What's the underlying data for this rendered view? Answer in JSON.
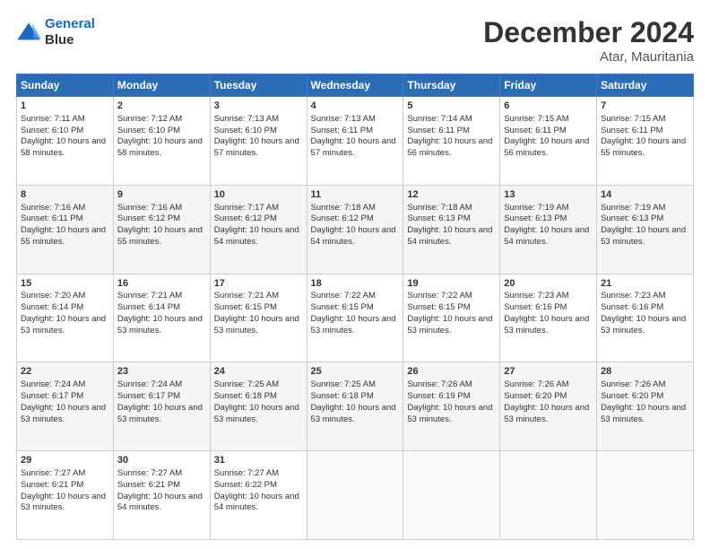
{
  "header": {
    "logo_line1": "General",
    "logo_line2": "Blue",
    "month_title": "December 2024",
    "location": "Atar, Mauritania"
  },
  "weekdays": [
    "Sunday",
    "Monday",
    "Tuesday",
    "Wednesday",
    "Thursday",
    "Friday",
    "Saturday"
  ],
  "weeks": [
    [
      {
        "day": "1",
        "sunrise": "7:11 AM",
        "sunset": "6:10 PM",
        "daylight": "10 hours and 58 minutes."
      },
      {
        "day": "2",
        "sunrise": "7:12 AM",
        "sunset": "6:10 PM",
        "daylight": "10 hours and 58 minutes."
      },
      {
        "day": "3",
        "sunrise": "7:13 AM",
        "sunset": "6:10 PM",
        "daylight": "10 hours and 57 minutes."
      },
      {
        "day": "4",
        "sunrise": "7:13 AM",
        "sunset": "6:11 PM",
        "daylight": "10 hours and 57 minutes."
      },
      {
        "day": "5",
        "sunrise": "7:14 AM",
        "sunset": "6:11 PM",
        "daylight": "10 hours and 56 minutes."
      },
      {
        "day": "6",
        "sunrise": "7:15 AM",
        "sunset": "6:11 PM",
        "daylight": "10 hours and 56 minutes."
      },
      {
        "day": "7",
        "sunrise": "7:15 AM",
        "sunset": "6:11 PM",
        "daylight": "10 hours and 55 minutes."
      }
    ],
    [
      {
        "day": "8",
        "sunrise": "7:16 AM",
        "sunset": "6:11 PM",
        "daylight": "10 hours and 55 minutes."
      },
      {
        "day": "9",
        "sunrise": "7:16 AM",
        "sunset": "6:12 PM",
        "daylight": "10 hours and 55 minutes."
      },
      {
        "day": "10",
        "sunrise": "7:17 AM",
        "sunset": "6:12 PM",
        "daylight": "10 hours and 54 minutes."
      },
      {
        "day": "11",
        "sunrise": "7:18 AM",
        "sunset": "6:12 PM",
        "daylight": "10 hours and 54 minutes."
      },
      {
        "day": "12",
        "sunrise": "7:18 AM",
        "sunset": "6:13 PM",
        "daylight": "10 hours and 54 minutes."
      },
      {
        "day": "13",
        "sunrise": "7:19 AM",
        "sunset": "6:13 PM",
        "daylight": "10 hours and 54 minutes."
      },
      {
        "day": "14",
        "sunrise": "7:19 AM",
        "sunset": "6:13 PM",
        "daylight": "10 hours and 53 minutes."
      }
    ],
    [
      {
        "day": "15",
        "sunrise": "7:20 AM",
        "sunset": "6:14 PM",
        "daylight": "10 hours and 53 minutes."
      },
      {
        "day": "16",
        "sunrise": "7:21 AM",
        "sunset": "6:14 PM",
        "daylight": "10 hours and 53 minutes."
      },
      {
        "day": "17",
        "sunrise": "7:21 AM",
        "sunset": "6:15 PM",
        "daylight": "10 hours and 53 minutes."
      },
      {
        "day": "18",
        "sunrise": "7:22 AM",
        "sunset": "6:15 PM",
        "daylight": "10 hours and 53 minutes."
      },
      {
        "day": "19",
        "sunrise": "7:22 AM",
        "sunset": "6:15 PM",
        "daylight": "10 hours and 53 minutes."
      },
      {
        "day": "20",
        "sunrise": "7:23 AM",
        "sunset": "6:16 PM",
        "daylight": "10 hours and 53 minutes."
      },
      {
        "day": "21",
        "sunrise": "7:23 AM",
        "sunset": "6:16 PM",
        "daylight": "10 hours and 53 minutes."
      }
    ],
    [
      {
        "day": "22",
        "sunrise": "7:24 AM",
        "sunset": "6:17 PM",
        "daylight": "10 hours and 53 minutes."
      },
      {
        "day": "23",
        "sunrise": "7:24 AM",
        "sunset": "6:17 PM",
        "daylight": "10 hours and 53 minutes."
      },
      {
        "day": "24",
        "sunrise": "7:25 AM",
        "sunset": "6:18 PM",
        "daylight": "10 hours and 53 minutes."
      },
      {
        "day": "25",
        "sunrise": "7:25 AM",
        "sunset": "6:18 PM",
        "daylight": "10 hours and 53 minutes."
      },
      {
        "day": "26",
        "sunrise": "7:26 AM",
        "sunset": "6:19 PM",
        "daylight": "10 hours and 53 minutes."
      },
      {
        "day": "27",
        "sunrise": "7:26 AM",
        "sunset": "6:20 PM",
        "daylight": "10 hours and 53 minutes."
      },
      {
        "day": "28",
        "sunrise": "7:26 AM",
        "sunset": "6:20 PM",
        "daylight": "10 hours and 53 minutes."
      }
    ],
    [
      {
        "day": "29",
        "sunrise": "7:27 AM",
        "sunset": "6:21 PM",
        "daylight": "10 hours and 53 minutes."
      },
      {
        "day": "30",
        "sunrise": "7:27 AM",
        "sunset": "6:21 PM",
        "daylight": "10 hours and 54 minutes."
      },
      {
        "day": "31",
        "sunrise": "7:27 AM",
        "sunset": "6:22 PM",
        "daylight": "10 hours and 54 minutes."
      },
      null,
      null,
      null,
      null
    ]
  ]
}
